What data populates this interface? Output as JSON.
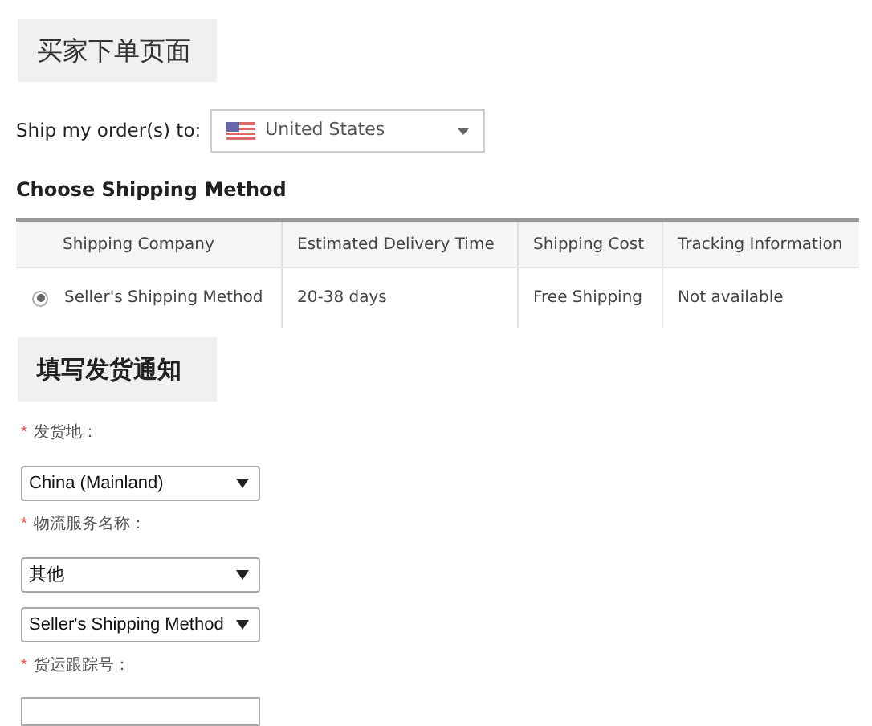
{
  "page_title": "买家下单页面",
  "ship_to": {
    "label": "Ship my order(s) to:",
    "value": "United States"
  },
  "section_title": "Choose Shipping Method",
  "table": {
    "columns": [
      "Shipping Company",
      "Estimated Delivery Time",
      "Shipping Cost",
      "Tracking Information"
    ],
    "rows": [
      {
        "selected": true,
        "cells": [
          "Seller's Shipping Method",
          "20-38 days",
          "Free Shipping",
          "Not available"
        ]
      }
    ]
  },
  "notice_title": "填写发货通知",
  "form": [
    {
      "kind": "label",
      "mark": "*",
      "text": "发货地："
    },
    {
      "kind": "select",
      "value": "China (Mainland)"
    },
    {
      "kind": "label",
      "mark": "*",
      "text": "物流服务名称："
    },
    {
      "kind": "select",
      "value": "其他"
    },
    {
      "kind": "select",
      "value": "Seller's Shipping Method"
    },
    {
      "kind": "label",
      "mark": "*",
      "text": "货运跟踪号："
    },
    {
      "kind": "input"
    }
  ]
}
